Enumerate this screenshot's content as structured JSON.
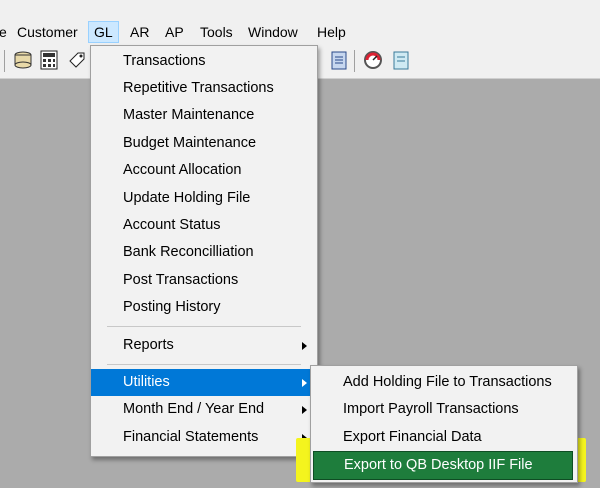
{
  "menubar": {
    "items": [
      {
        "label": "e"
      },
      {
        "label": "Customer"
      },
      {
        "label": "GL"
      },
      {
        "label": "AR"
      },
      {
        "label": "AP"
      },
      {
        "label": "Tools"
      },
      {
        "label": "Window"
      },
      {
        "label": "Help"
      }
    ],
    "active": "GL"
  },
  "toolbar": {
    "icons": [
      "disk-stack-icon",
      "calculator-icon",
      "tag-icon",
      "clipboard-icon",
      "gauge-icon",
      "notepad-icon"
    ]
  },
  "gl_menu": {
    "items": [
      {
        "label": "Transactions"
      },
      {
        "label": "Repetitive Transactions"
      },
      {
        "label": "Master Maintenance"
      },
      {
        "label": "Budget Maintenance"
      },
      {
        "label": "Account Allocation"
      },
      {
        "label": "Update Holding File"
      },
      {
        "label": "Account Status"
      },
      {
        "label": "Bank Reconcilliation"
      },
      {
        "label": "Post Transactions"
      },
      {
        "label": "Posting History"
      },
      {
        "label": "Reports"
      },
      {
        "label": "Utilities"
      },
      {
        "label": "Month End / Year End"
      },
      {
        "label": "Financial Statements"
      }
    ],
    "highlighted": "Utilities"
  },
  "utilities_menu": {
    "items": [
      {
        "label": "Add Holding File to Transactions"
      },
      {
        "label": "Import Payroll Transactions"
      },
      {
        "label": "Export Financial Data"
      },
      {
        "label": "Export to QB Desktop IIF File"
      }
    ],
    "highlighted": "Export to QB Desktop IIF File"
  },
  "colors": {
    "menu_highlight": "#0078d7",
    "annotation_highlight": "#f4f41e",
    "selected_green": "#1e7d3c"
  }
}
